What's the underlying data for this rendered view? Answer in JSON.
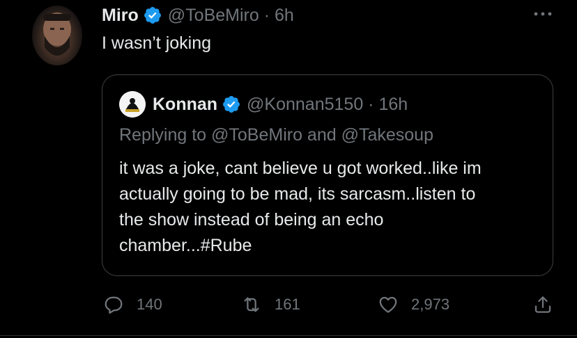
{
  "tweet": {
    "author_name": "Miro",
    "author_handle_time": "@ToBeMiro · 6h",
    "text": "I wasn’t joking"
  },
  "quoted_tweet": {
    "author_name": "Konnan",
    "author_handle_time": "@Konnan5150 · 16h",
    "replying_to": "Replying to @ToBeMiro and @Takesoup",
    "body_lines": [
      "it was a joke, cant believe u got worked..like im",
      "actually going to be mad, its sarcasm..listen to",
      "the show instead of being an echo",
      "chamber...#Rube"
    ]
  },
  "actions": {
    "replies": "140",
    "retweets": "161",
    "likes": "2,973"
  },
  "colors": {
    "background": "#000000",
    "primary_text": "#e7e9ea",
    "secondary_text": "#71767b",
    "verified_badge": "#1d9bf0",
    "border": "#3e4144"
  },
  "icons": [
    "verified-badge-icon",
    "more-options-icon",
    "reply-icon",
    "retweet-icon",
    "like-icon",
    "share-icon"
  ]
}
